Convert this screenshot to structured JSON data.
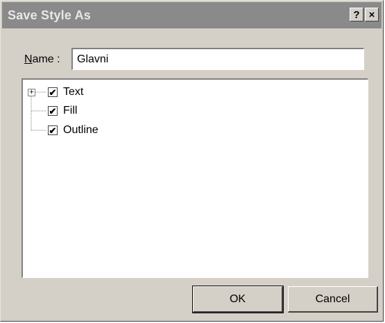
{
  "dialog": {
    "title": "Save Style As",
    "help_label": "?",
    "close_label": "×"
  },
  "name_field": {
    "label_mnemonic": "N",
    "label_rest": "ame :",
    "value": "Glavni"
  },
  "tree": {
    "expander": "+",
    "items": [
      {
        "label": "Text",
        "checked": true
      },
      {
        "label": "Fill",
        "checked": true
      },
      {
        "label": "Outline",
        "checked": true
      }
    ]
  },
  "buttons": {
    "ok": "OK",
    "cancel": "Cancel"
  }
}
